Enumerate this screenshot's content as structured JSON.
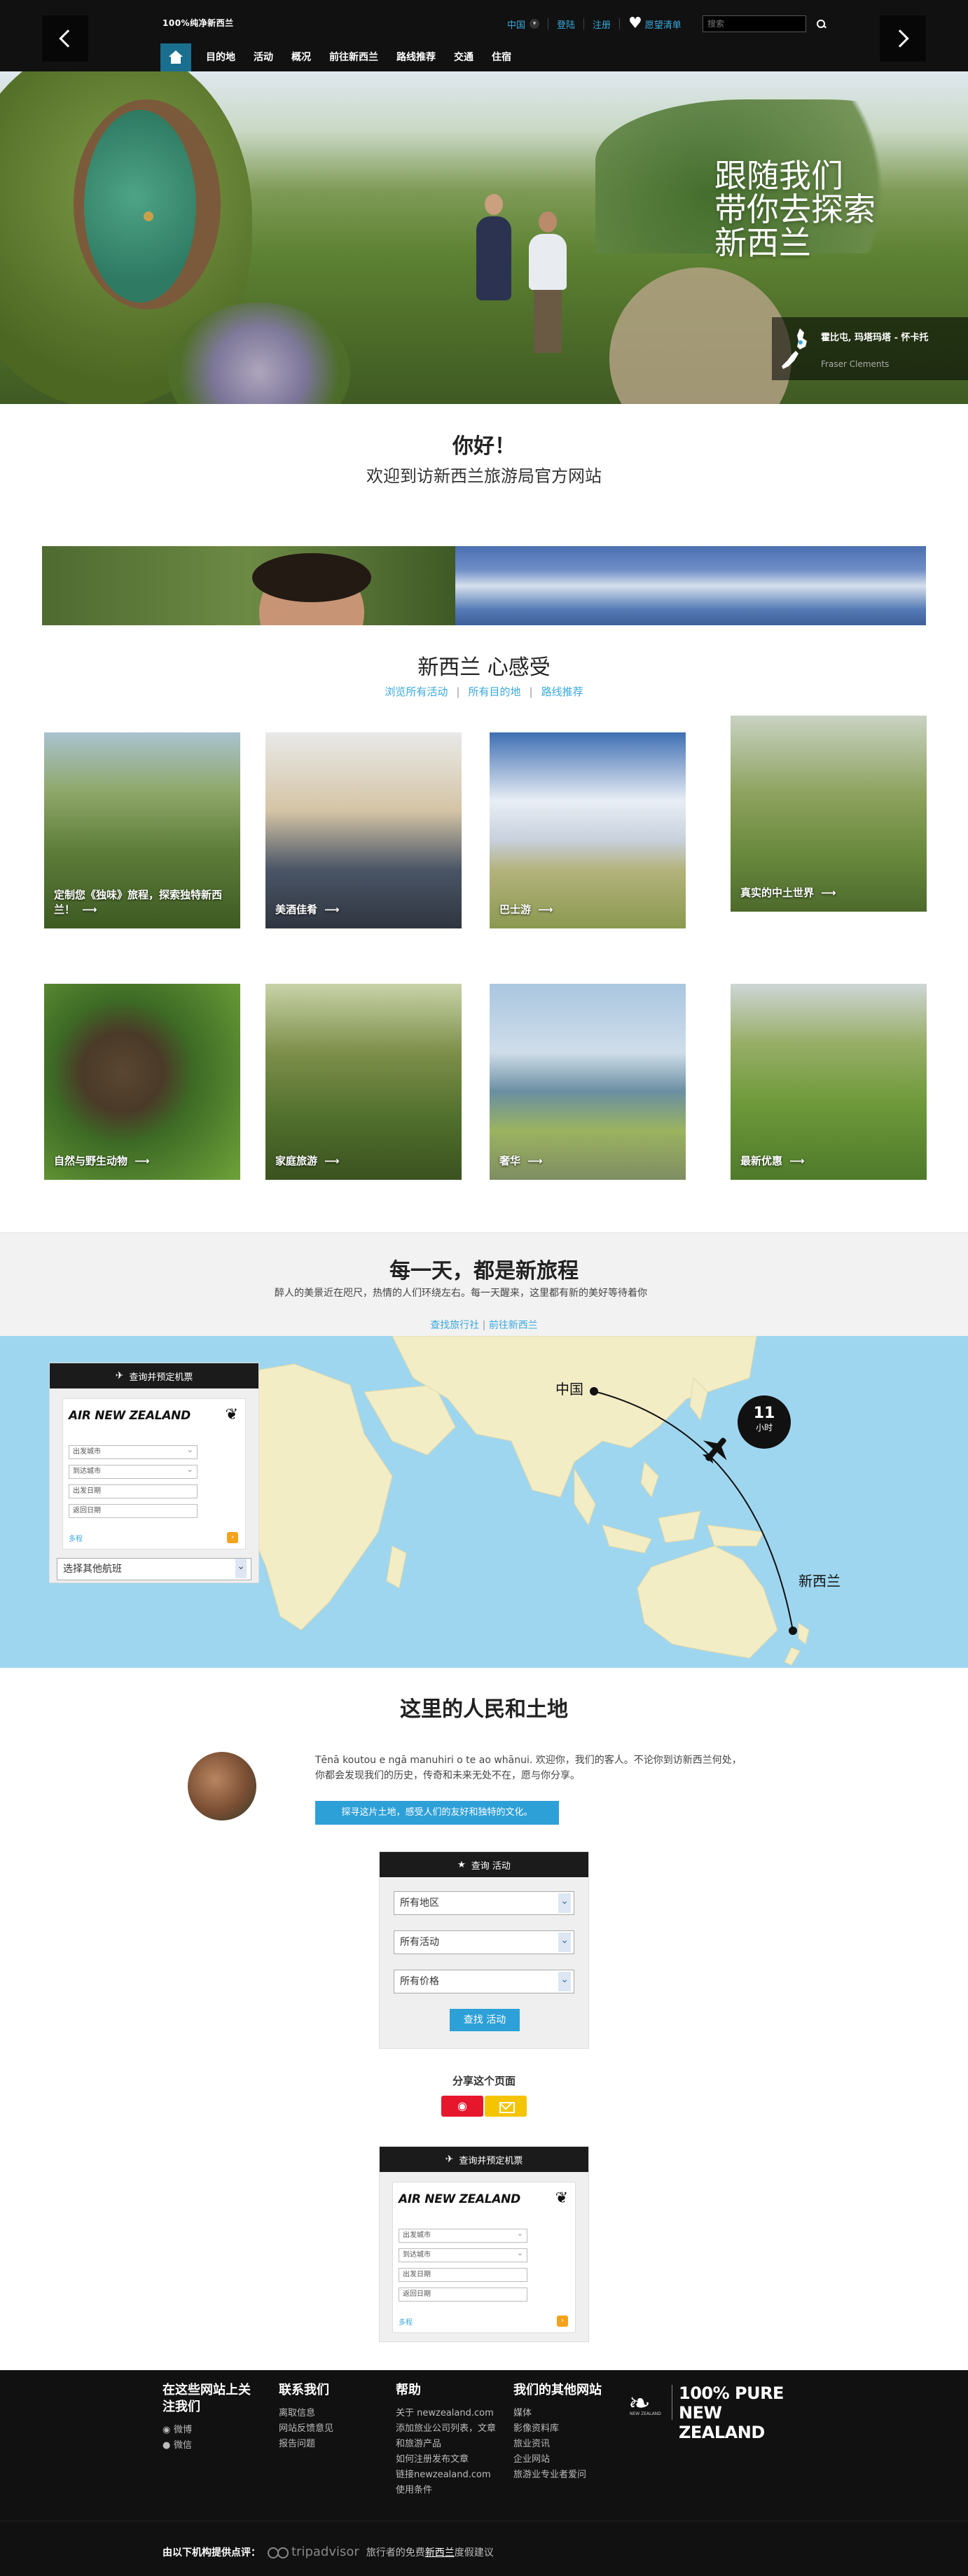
{
  "header": {
    "logo": "100%纯净新西兰",
    "lang": "中国",
    "login": "登陆",
    "register": "注册",
    "wishlist": "愿望清单",
    "search_placeholder": "搜索"
  },
  "nav": {
    "items": [
      "目的地",
      "活动",
      "概况",
      "前往新西兰",
      "路线推荐",
      "交通",
      "住宿"
    ]
  },
  "hero": {
    "title_lines": [
      "跟随我们",
      "带你去探索",
      "新西兰"
    ],
    "place": "霍比屯, 玛塔玛塔 - 怀卡托",
    "credit": "Fraser Clements"
  },
  "welcome": {
    "title": "你好！",
    "subtitle": "欢迎到访新西兰旅游局官方网站"
  },
  "feel": {
    "title": "新西兰 心感受",
    "links": [
      "浏览所有活动",
      "所有目的地",
      "路线推荐"
    ],
    "tiles": [
      "定制您《独味》旅程，探索独特新西兰！",
      "美酒佳肴",
      "巴士游",
      "真实的中土世界",
      "自然与野生动物",
      "家庭旅游",
      "奢华",
      "最新优惠"
    ]
  },
  "everyday": {
    "title": "每一天，都是新旅程",
    "text": "醉人的美景近在咫尺，热情的人们环绕左右。每一天醒来，这里都有新的美好等待着你",
    "links": [
      "查找旅行社",
      "前往新西兰"
    ]
  },
  "map": {
    "origin": "中国",
    "destination": "新西兰",
    "hours": "11",
    "hours_unit": "小时"
  },
  "flight": {
    "title": "查询并预定机票",
    "airline": "AIR NEW ZEALAND",
    "fields": [
      "出发城市",
      "到达城市",
      "出发日期",
      "返回日期"
    ],
    "more": "多程",
    "other": "选择其他航班"
  },
  "people": {
    "title": "这里的人民和土地",
    "text": "Tēnā koutou e ngā manuhiri o te ao whānui. 欢迎你，我们的客人。不论你到访新西兰何处，你都会发现我们的历史，传奇和未来无处不在，愿与你分享。",
    "button": "探寻这片土地，感受人们的友好和独特的文化。"
  },
  "activity": {
    "title": "查询 活动",
    "region": "所有地区",
    "type": "所有活动",
    "price": "所有价格",
    "button": "查找 活动"
  },
  "share": {
    "title": "分享这个页面"
  },
  "footer": {
    "col1": {
      "title": "在这些网站上关注我们",
      "links": [
        "微博",
        "微信"
      ]
    },
    "col2": {
      "title": "联系我们",
      "links": [
        "离取信息",
        "网站反馈意见",
        "报告问题"
      ]
    },
    "col3": {
      "title": "帮助",
      "links": [
        "关于 newzealand.com",
        "添加旅业公司列表，文章和旅游产品",
        "如何注册发布文章",
        "链接newzealand.com",
        "使用条件"
      ]
    },
    "col4": {
      "title": "我们的其他网站",
      "links": [
        "媒体",
        "影像资料库",
        "旅业资讯",
        "企业网站",
        "旅游业专业者爱问"
      ]
    },
    "brand_line1": "100% PURE",
    "brand_line2": "NEW ZEALAND",
    "brand_small": "NEW ZEALAND",
    "reviews_label": "由以下机构提供点评：",
    "tripadvisor": "tripadvisor",
    "reviews_text_a": "旅行者的免费",
    "reviews_link": "新西兰",
    "reviews_text_b": "度假建议"
  }
}
